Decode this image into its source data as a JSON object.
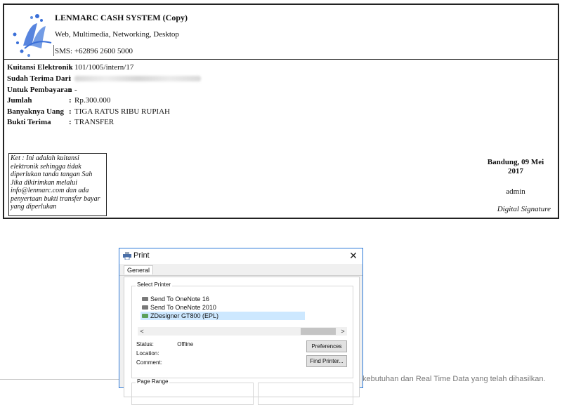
{
  "receipt": {
    "title": "LENMARC CASH SYSTEM (Copy)",
    "subtitle": "Web, Multimedia, Networking, Desktop",
    "sms": "SMS: +62896 2600 5000",
    "fields": [
      {
        "label": "Kuitansi Elektronik",
        "value": "101/1005/intern/17"
      },
      {
        "label": "Sudah Terima Dari",
        "value": ""
      },
      {
        "label": "Untuk Pembayaran",
        "value": "-"
      },
      {
        "label": "Jumlah",
        "value": "Rp.300.000"
      },
      {
        "label": "Banyaknya Uang",
        "value": "TIGA RATUS RIBU RUPIAH"
      },
      {
        "label": "Bukti Terima",
        "value": "TRANSFER"
      }
    ],
    "note": "Ket : Ini adalah kuitansi elektronik sehingga tidak diperlukan tanda tangan Sah Jika dikirimkan melalui info@lenmarc.com dan ada penyertaan bukti transfer bayar yang diperlukan",
    "signature_date": "Bandung, 09 Mei 2017",
    "signature_name": "admin",
    "signature_label": "Digital Signature"
  },
  "dialog": {
    "title": "Print",
    "close": "✕",
    "tab": "General",
    "select_printer_label": "Select Printer",
    "printers": [
      "Send To OneNote 16",
      "Send To OneNote 2010",
      "ZDesigner GT800 (EPL)"
    ],
    "selected_printer_index": 2,
    "status_label": "Status:",
    "status_value": "Offline",
    "location_label": "Location:",
    "comment_label": "Comment:",
    "preferences_button": "Preferences",
    "find_printer_button": "Find Printer...",
    "page_range_label": "Page Range",
    "scroll_left": "<",
    "scroll_right": ">"
  },
  "background_text": "kebutuhan dan Real Time Data yang telah dihasilkan.",
  "colors": {
    "dialog_border": "#2b79d8",
    "selected_row": "#cde8ff",
    "logo_blue": "#3a6fd8"
  }
}
